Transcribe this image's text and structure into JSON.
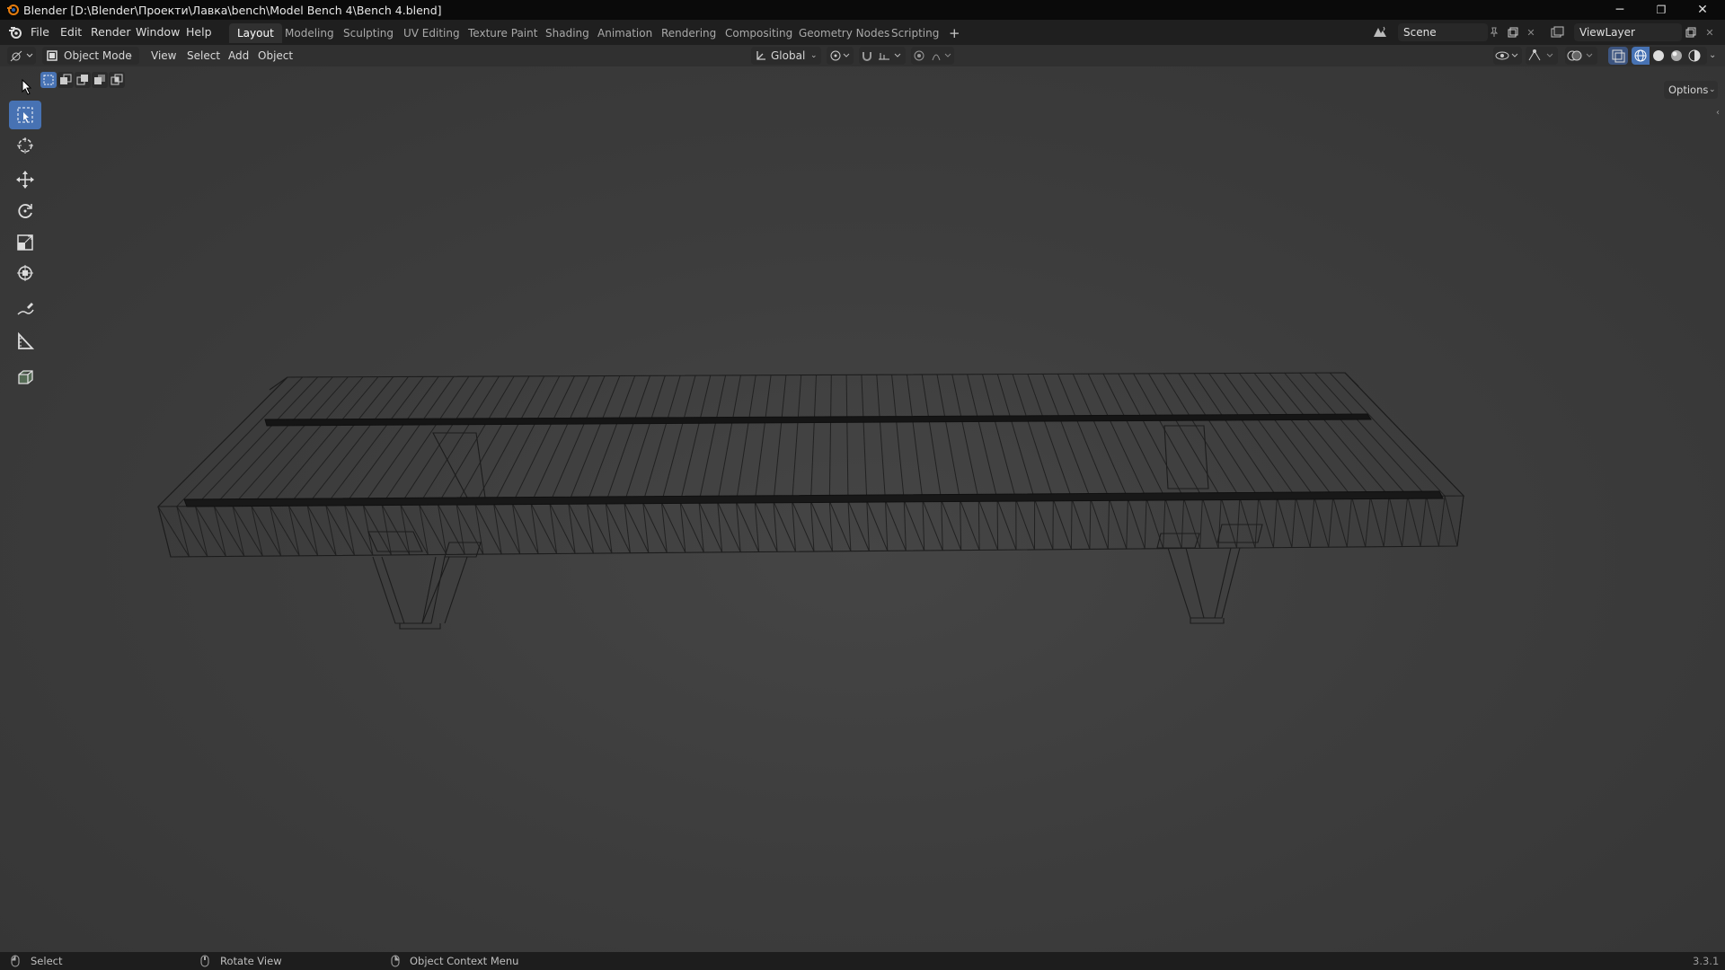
{
  "window": {
    "title": "Blender [D:\\Blender\\Проекти\\Лавка\\bench\\Model Bench 4\\Bench 4.blend]",
    "minimize": "─",
    "restore": "❐",
    "close": "✕"
  },
  "menu": {
    "file": "File",
    "edit": "Edit",
    "render": "Render",
    "window": "Window",
    "help": "Help"
  },
  "workspaces": [
    "Layout",
    "Modeling",
    "Sculpting",
    "UV Editing",
    "Texture Paint",
    "Shading",
    "Animation",
    "Rendering",
    "Compositing",
    "Geometry Nodes",
    "Scripting"
  ],
  "active_workspace": "Layout",
  "add_workspace": "+",
  "scene": {
    "name": "Scene"
  },
  "view_layer": {
    "name": "ViewLayer"
  },
  "viewport_header": {
    "mode": "Object Mode",
    "view": "View",
    "select": "Select",
    "add": "Add",
    "object": "Object",
    "orientation": "Global",
    "options": "Options"
  },
  "toolbar": {
    "tools": [
      "select-box",
      "cursor",
      "move",
      "rotate",
      "scale",
      "transform",
      "annotate",
      "measure",
      "add-cube"
    ],
    "active": "select-box",
    "accent": "#4772b3"
  },
  "status_bar": {
    "select": "Select",
    "rotate_view": "Rotate View",
    "context_menu": "Object Context Menu",
    "version": "3.3.1"
  }
}
